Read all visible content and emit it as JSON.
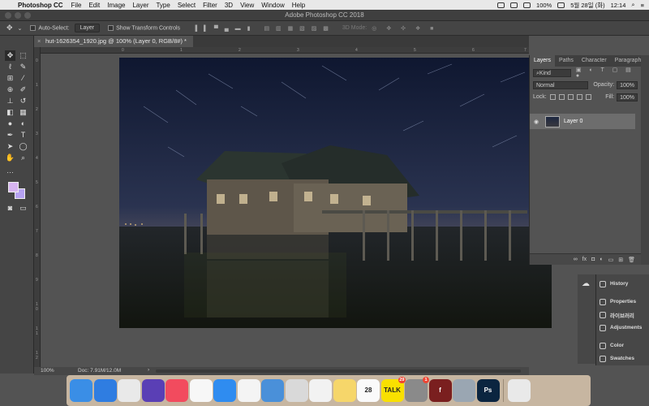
{
  "menubar": {
    "app_name": "Photoshop CC",
    "menus": [
      "File",
      "Edit",
      "Image",
      "Layer",
      "Type",
      "Select",
      "Filter",
      "3D",
      "View",
      "Window",
      "Help"
    ],
    "battery": "100%",
    "date": "5월 28일 (화)",
    "time": "12:14"
  },
  "window": {
    "title": "Adobe Photoshop CC 2018"
  },
  "options": {
    "auto_select_label": "Auto-Select:",
    "auto_select_value": "Layer",
    "transform_label": "Show Transform Controls",
    "mode_3d": "3D Mode:"
  },
  "document": {
    "tab_title": "hut-1626354_1920.jpg @ 100% (Layer 0, RGB/8#) *",
    "zoom": "100%",
    "doc_size": "Doc: 7.91M/12.0M"
  },
  "rulers": {
    "top": [
      "0",
      "1",
      "2",
      "3",
      "4",
      "5",
      "6",
      "7"
    ],
    "left": [
      "0",
      "1",
      "2",
      "3",
      "4",
      "5",
      "6",
      "7",
      "8",
      "9",
      "1 0",
      "1 1",
      "1 2"
    ]
  },
  "layers_panel": {
    "tabs": [
      "Layers",
      "Paths",
      "Character",
      "Paragraph"
    ],
    "kind": "Kind",
    "blend_mode": "Normal",
    "opacity_label": "Opacity:",
    "opacity_value": "100%",
    "lock_label": "Lock:",
    "fill_label": "Fill:",
    "fill_value": "100%",
    "layers": [
      {
        "name": "Layer 0",
        "visible": true
      }
    ]
  },
  "right_rail": {
    "items": [
      "History",
      "Properties",
      "라이브러리",
      "Adjustments",
      "Color",
      "Swatches"
    ]
  },
  "dock": {
    "items": [
      {
        "name": "Finder",
        "color": "#3a8ee6"
      },
      {
        "name": "Safari",
        "color": "#2f7de1"
      },
      {
        "name": "Chrome",
        "color": "#e9e9e9"
      },
      {
        "name": "Siri",
        "color": "#5a3fb5"
      },
      {
        "name": "Music",
        "color": "#f24b5e"
      },
      {
        "name": "Photos",
        "color": "#f7f7f7"
      },
      {
        "name": "App Store",
        "color": "#2f8cf0"
      },
      {
        "name": "Numbers",
        "color": "#f4f4f4"
      },
      {
        "name": "Keynote",
        "color": "#4a90d9"
      },
      {
        "name": "Preview",
        "color": "#d9d9d9"
      },
      {
        "name": "TextEdit",
        "color": "#f2f2f2"
      },
      {
        "name": "Notes",
        "color": "#f6d66a"
      },
      {
        "name": "Calendar",
        "color": "#fafafa",
        "label": "28"
      },
      {
        "name": "KakaoTalk",
        "color": "#f9e000",
        "label": "TALK",
        "badge": "29"
      },
      {
        "name": "System Preferences",
        "color": "#8a8a8a",
        "badge": "1"
      },
      {
        "name": "Flash",
        "color": "#7a1f1f",
        "label": "f"
      },
      {
        "name": "Image Capture",
        "color": "#9aa6b2"
      },
      {
        "name": "Photoshop",
        "color": "#0b2540",
        "label": "Ps"
      },
      {
        "name": "Trash",
        "color": "#e9e9e9"
      }
    ]
  },
  "colors": {
    "foreground": "#d6b4f0",
    "background": "#b6a2f2",
    "panel_bg": "#535353",
    "dock_bg": "#dcc8af"
  }
}
